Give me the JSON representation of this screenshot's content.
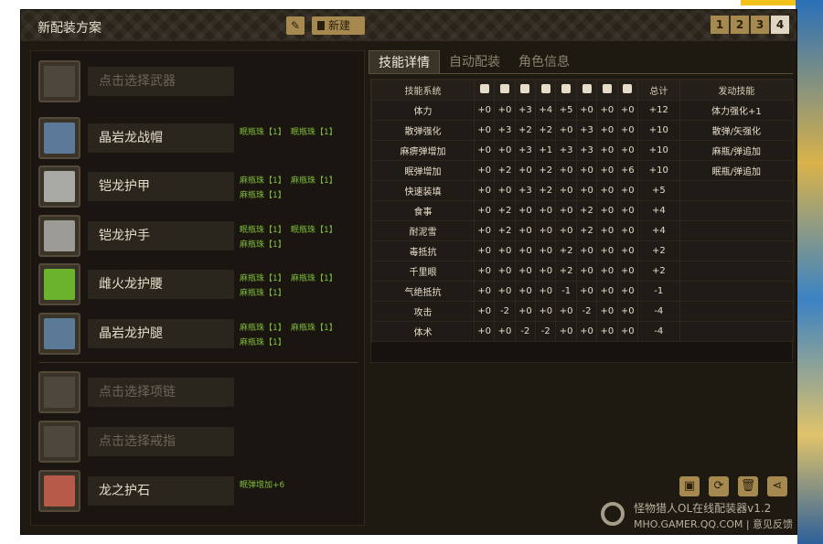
{
  "app": {
    "title": "新配装方案",
    "new_label": "新建",
    "slots": [
      "1",
      "2",
      "3",
      "4"
    ],
    "active_slot": "4"
  },
  "equipment": [
    {
      "name": "点击选择武器",
      "empty": true,
      "gems": []
    },
    {
      "name": "晶岩龙战帽",
      "empty": false,
      "gems": [
        "眠瓶珠【1】",
        "眠瓶珠【1】"
      ]
    },
    {
      "name": "铠龙护甲",
      "empty": false,
      "gems": [
        "麻瓶珠【1】",
        "麻瓶珠【1】",
        "麻瓶珠【1】"
      ]
    },
    {
      "name": "铠龙护手",
      "empty": false,
      "gems": [
        "眠瓶珠【1】",
        "眠瓶珠【1】",
        "麻瓶珠【1】"
      ]
    },
    {
      "name": "雌火龙护腰",
      "empty": false,
      "gems": [
        "麻瓶珠【1】",
        "麻瓶珠【1】",
        "麻瓶珠【1】"
      ]
    },
    {
      "name": "晶岩龙护腿",
      "empty": false,
      "gems": [
        "麻瓶珠【1】",
        "麻瓶珠【1】",
        "麻瓶珠【1】"
      ]
    },
    {
      "name": "点击选择项链",
      "empty": true,
      "gems": []
    },
    {
      "name": "点击选择戒指",
      "empty": true,
      "gems": []
    },
    {
      "name": "龙之护石",
      "empty": false,
      "gems": [
        "眠弹增加+6"
      ]
    }
  ],
  "tabs": [
    "技能详情",
    "自动配装",
    "角色信息"
  ],
  "skills": {
    "headers": {
      "name": "技能系统",
      "total": "总计",
      "activated": "发动技能"
    },
    "rows": [
      {
        "name": "体力",
        "values": [
          "+0",
          "+0",
          "+3",
          "+4",
          "+5",
          "+0",
          "+0",
          "+0"
        ],
        "total": "+12",
        "activated": "体力强化+1"
      },
      {
        "name": "散弹强化",
        "values": [
          "+0",
          "+3",
          "+2",
          "+2",
          "+0",
          "+3",
          "+0",
          "+0"
        ],
        "total": "+10",
        "activated": "散弹/矢强化"
      },
      {
        "name": "麻痹弹增加",
        "values": [
          "+0",
          "+0",
          "+3",
          "+1",
          "+3",
          "+3",
          "+0",
          "+0"
        ],
        "total": "+10",
        "activated": "麻瓶/弹追加"
      },
      {
        "name": "眠弹增加",
        "values": [
          "+0",
          "+2",
          "+0",
          "+2",
          "+0",
          "+0",
          "+0",
          "+6"
        ],
        "total": "+10",
        "activated": "眠瓶/弹追加"
      },
      {
        "name": "快速装填",
        "values": [
          "+0",
          "+0",
          "+3",
          "+2",
          "+0",
          "+0",
          "+0",
          "+0"
        ],
        "total": "+5",
        "activated": ""
      },
      {
        "name": "食事",
        "values": [
          "+0",
          "+2",
          "+0",
          "+0",
          "+0",
          "+2",
          "+0",
          "+0"
        ],
        "total": "+4",
        "activated": ""
      },
      {
        "name": "耐泥雪",
        "values": [
          "+0",
          "+2",
          "+0",
          "+0",
          "+0",
          "+2",
          "+0",
          "+0"
        ],
        "total": "+4",
        "activated": ""
      },
      {
        "name": "毒抵抗",
        "values": [
          "+0",
          "+0",
          "+0",
          "+0",
          "+2",
          "+0",
          "+0",
          "+0"
        ],
        "total": "+2",
        "activated": ""
      },
      {
        "name": "千里眼",
        "values": [
          "+0",
          "+0",
          "+0",
          "+0",
          "+2",
          "+0",
          "+0",
          "+0"
        ],
        "total": "+2",
        "activated": ""
      },
      {
        "name": "气绝抵抗",
        "values": [
          "+0",
          "+0",
          "+0",
          "+0",
          "-1",
          "+0",
          "+0",
          "+0"
        ],
        "total": "-1",
        "activated": ""
      },
      {
        "name": "攻击",
        "values": [
          "+0",
          "-2",
          "+0",
          "+0",
          "+0",
          "-2",
          "+0",
          "+0"
        ],
        "total": "-4",
        "activated": ""
      },
      {
        "name": "体术",
        "values": [
          "+0",
          "+0",
          "-2",
          "-2",
          "+0",
          "+0",
          "+0",
          "+0"
        ],
        "total": "-4",
        "activated": ""
      }
    ]
  },
  "footer": {
    "title": "怪物猎人OL在线配装器v1.2",
    "link": "MHO.GAMER.QQ.COM | 意见反馈"
  },
  "colors": {
    "accent": "#a6894e",
    "gem": "#7fbf3a",
    "bg": "#1e1911"
  }
}
